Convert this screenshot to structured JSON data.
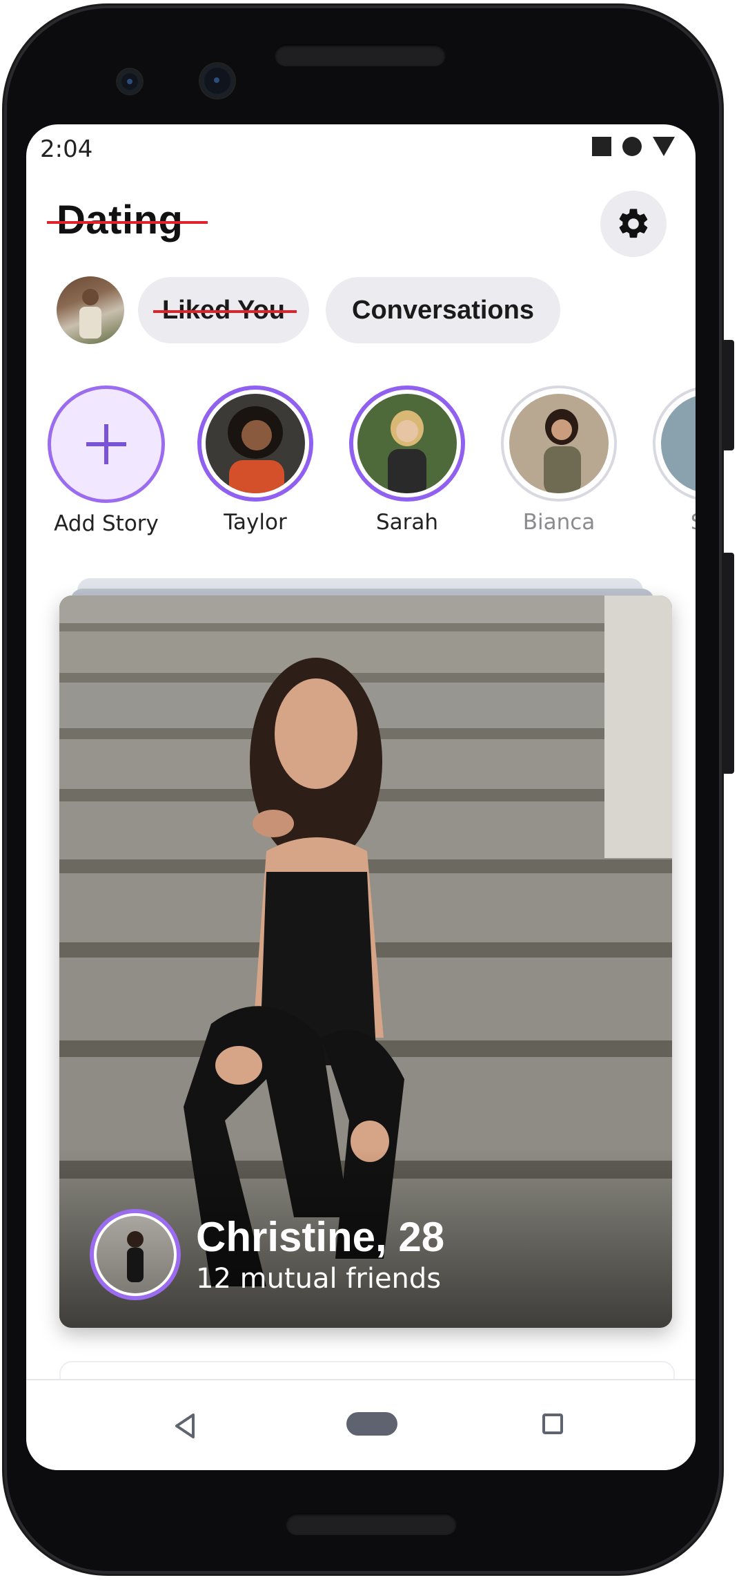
{
  "status_bar": {
    "time": "2:04"
  },
  "header": {
    "title": "Dating"
  },
  "pills": {
    "liked_you": "Liked You",
    "conversations": "Conversations"
  },
  "stories": [
    {
      "name": "Add Story"
    },
    {
      "name": "Taylor"
    },
    {
      "name": "Sarah"
    },
    {
      "name": "Bianca"
    },
    {
      "name": "Spe"
    }
  ],
  "profile_card": {
    "name_age": "Christine, 28",
    "mutual": "12 mutual friends"
  },
  "colors": {
    "accent": "#9061f0",
    "strike": "#e0222c",
    "pill_bg": "#ececf0"
  }
}
